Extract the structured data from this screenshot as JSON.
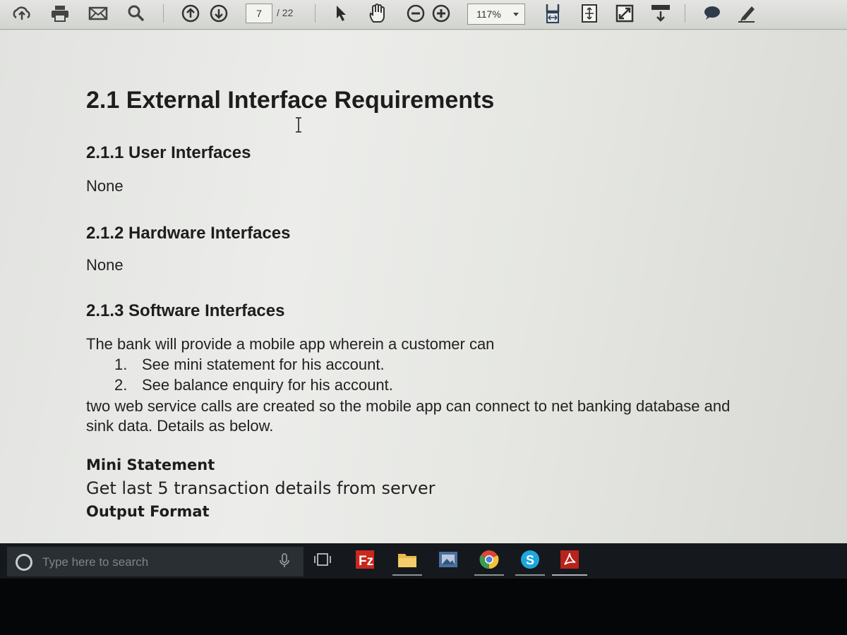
{
  "toolbar": {
    "page_current": "7",
    "page_total": "/ 22",
    "zoom": "117%",
    "icons": [
      "cloud-upload-icon",
      "print-icon",
      "mail-icon",
      "search-icon",
      "page-up-icon",
      "page-down-icon",
      "select-arrow-icon",
      "hand-icon",
      "zoom-out-icon",
      "zoom-in-icon",
      "fit-width-icon",
      "fit-page-icon",
      "fullscreen-icon",
      "read-mode-icon",
      "comment-icon",
      "sign-icon"
    ]
  },
  "document": {
    "heading": "2.1 External Interface Requirements",
    "section1_title": "2.1.1 User Interfaces",
    "section1_body": "None",
    "section2_title": "2.1.2 Hardware Interfaces",
    "section2_body": "None",
    "section3_title": "2.1.3 Software Interfaces",
    "section3_intro": "The bank will provide a mobile app wherein a customer can",
    "list": [
      {
        "num": "1.",
        "text": "See mini statement for his account."
      },
      {
        "num": "2.",
        "text": "See balance enquiry for his account."
      }
    ],
    "para_line1": "two web service calls are created so the mobile app can connect to net banking database and",
    "para_line2": "sink data. Details as below.",
    "mini_title": "Mini Statement",
    "mini_body": "Get last 5 transaction details from server",
    "output_title": "Output Format"
  },
  "taskbar": {
    "search_placeholder": "Type here to search",
    "apps": [
      "task-view-icon",
      "filezilla-icon",
      "file-explorer-icon",
      "photos-icon",
      "chrome-icon",
      "skype-icon",
      "acrobat-icon"
    ]
  }
}
